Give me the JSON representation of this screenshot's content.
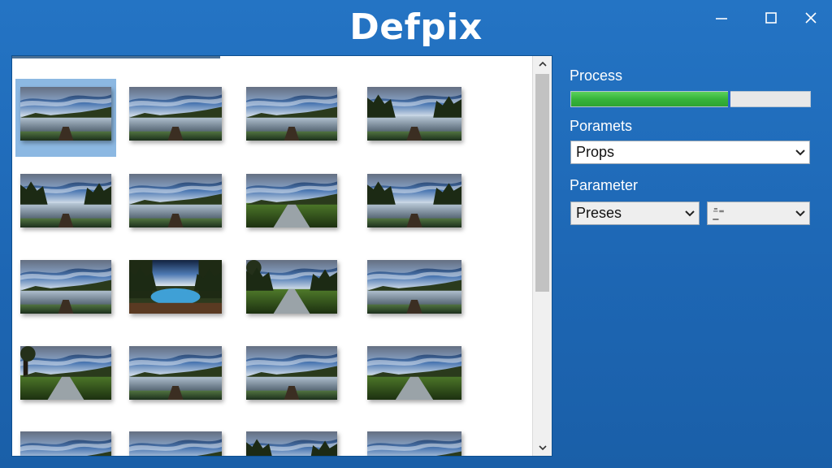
{
  "window": {
    "title": "Defpix",
    "controls": {
      "minimize_icon": "minimize-icon",
      "maximize_icon": "maximize-icon",
      "close_icon": "close-icon"
    }
  },
  "gallery": {
    "selected_index": 0,
    "thumbnails": [
      {
        "scene": "lake-sunrise"
      },
      {
        "scene": "river-clouds"
      },
      {
        "scene": "river-clouds"
      },
      {
        "scene": "river-forest"
      },
      {
        "scene": "forest-lake"
      },
      {
        "scene": "river-clouds"
      },
      {
        "scene": "path-field"
      },
      {
        "scene": "forest-lake"
      },
      {
        "scene": "river-field"
      },
      {
        "scene": "forest-pond"
      },
      {
        "scene": "forest-path"
      },
      {
        "scene": "river-field"
      },
      {
        "scene": "tree-road"
      },
      {
        "scene": "river-clouds"
      },
      {
        "scene": "river-clouds"
      },
      {
        "scene": "field-path"
      },
      {
        "scene": "river-clouds"
      },
      {
        "scene": "river-clouds"
      },
      {
        "scene": "forest-lake"
      },
      {
        "scene": "river-clouds"
      }
    ],
    "scroll_up_icon": "chevron-up-icon",
    "scroll_down_icon": "chevron-down-icon"
  },
  "panel": {
    "process_label": "Process",
    "progress_value": 0.66,
    "params_label": "Poramets",
    "params_select": "Props",
    "parameter_label": "Parameter",
    "parameter_select_1": "Preses",
    "parameter_select_2": "⁻̲̄⁼",
    "dropdown_icon": "chevron-down-icon"
  },
  "colors": {
    "window_bg": "#1f6bb8",
    "selection": "#8cb8e2",
    "progress_green": "#37b43a",
    "progress_cursor": "#2a67c9"
  }
}
